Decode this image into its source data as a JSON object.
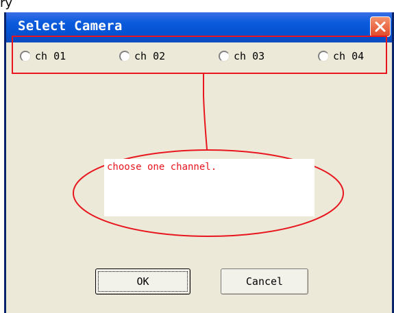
{
  "top_fragment": "ry",
  "dialog": {
    "title": "Select Camera",
    "close_icon": "close-x-icon"
  },
  "channels": [
    {
      "label": "ch 01",
      "selected": false
    },
    {
      "label": "ch 02",
      "selected": false
    },
    {
      "label": "ch 03",
      "selected": false
    },
    {
      "label": "ch 04",
      "selected": false
    }
  ],
  "annotation": {
    "text": "choose one channel.",
    "color": "#e8151e"
  },
  "buttons": {
    "ok": "OK",
    "cancel": "Cancel"
  },
  "colors": {
    "titlebar": "#0552d2",
    "window_bg": "#ece9d8",
    "annotation_red": "#e8151e",
    "close_button": "#e14a28"
  }
}
